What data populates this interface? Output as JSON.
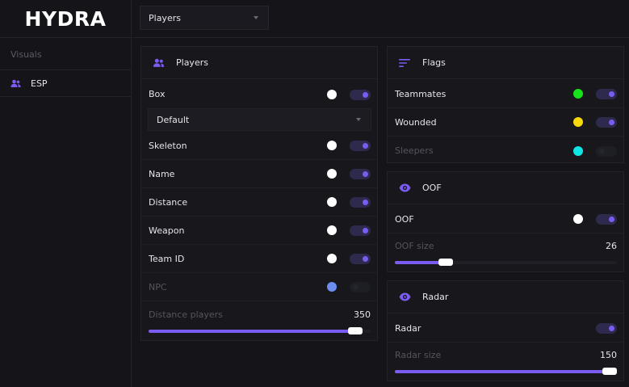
{
  "app": {
    "logo": "HYDRA"
  },
  "sidebar": {
    "section": "Visuals",
    "items": [
      {
        "label": "ESP",
        "icon": "users-icon"
      }
    ]
  },
  "topbar": {
    "dropdown_value": "Players"
  },
  "colors": {
    "accent": "#7b5cf0",
    "white": "#ffffff",
    "green": "#17e31a",
    "yellow": "#f5d90a",
    "cyan": "#0fe6e6",
    "blue": "#6b8ef0"
  },
  "players": {
    "title": "Players",
    "box": {
      "label": "Box",
      "color": "#ffffff",
      "enabled": true
    },
    "box_style": "Default",
    "skeleton": {
      "label": "Skeleton",
      "color": "#ffffff",
      "enabled": true
    },
    "name": {
      "label": "Name",
      "color": "#ffffff",
      "enabled": true
    },
    "distance": {
      "label": "Distance",
      "color": "#ffffff",
      "enabled": true
    },
    "weapon": {
      "label": "Weapon",
      "color": "#ffffff",
      "enabled": true
    },
    "team_id": {
      "label": "Team ID",
      "color": "#ffffff",
      "enabled": true
    },
    "npc": {
      "label": "NPC",
      "color": "#6b8ef0",
      "enabled": false
    },
    "distance_players": {
      "label": "Distance players",
      "value": "350",
      "fraction": 0.93
    }
  },
  "flags": {
    "title": "Flags",
    "teammates": {
      "label": "Teammates",
      "color": "#17e31a",
      "enabled": true
    },
    "wounded": {
      "label": "Wounded",
      "color": "#f5d90a",
      "enabled": true
    },
    "sleepers": {
      "label": "Sleepers",
      "color": "#0fe6e6",
      "enabled": false
    }
  },
  "oof": {
    "title": "OOF",
    "oof": {
      "label": "OOF",
      "color": "#ffffff",
      "enabled": true
    },
    "size": {
      "label": "OOF size",
      "value": "26",
      "fraction": 0.23
    }
  },
  "radar": {
    "title": "Radar",
    "radar": {
      "label": "Radar",
      "enabled": true
    },
    "size": {
      "label": "Radar size",
      "value": "150",
      "fraction": 0.99
    }
  }
}
